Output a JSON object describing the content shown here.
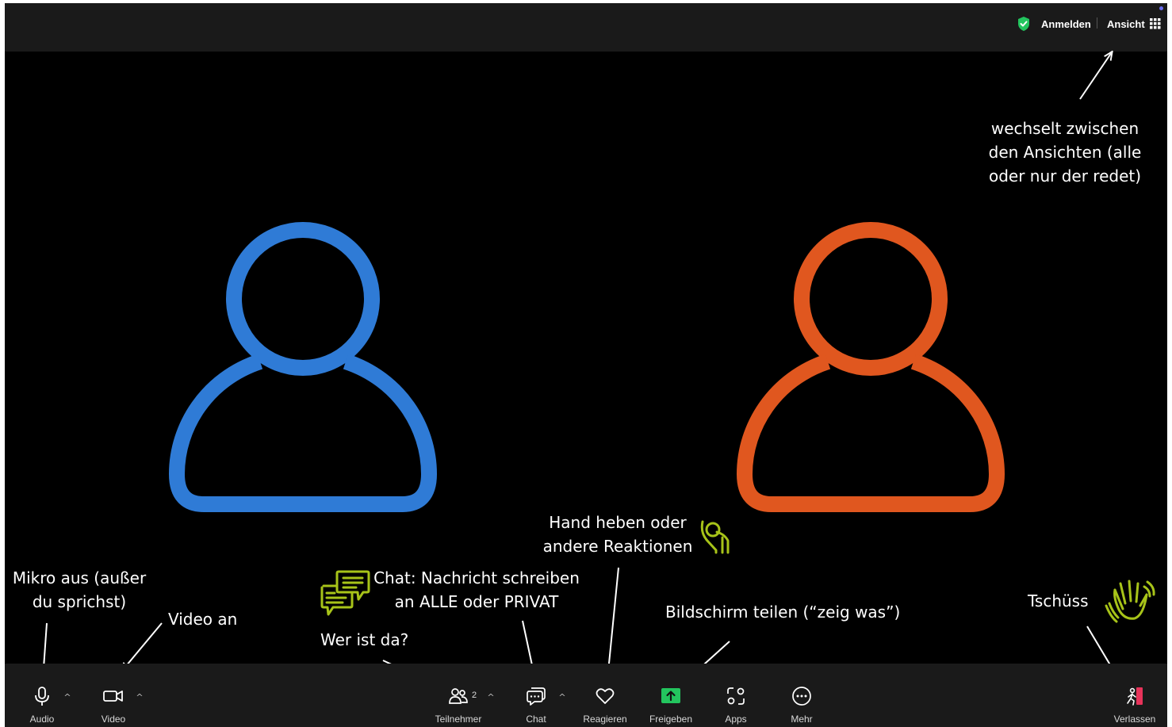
{
  "topbar": {
    "signin_label": "Anmelden",
    "view_label": "Ansicht",
    "shield_icon": "green-shield-check-icon",
    "grid_icon": "grid-icon"
  },
  "participants": [
    {
      "color": "#2f7bd6",
      "icon": "person-icon"
    },
    {
      "color": "#e0571f",
      "icon": "person-icon"
    }
  ],
  "toolbar": {
    "audio_label": "Audio",
    "video_label": "Video",
    "participants_label": "Teilnehmer",
    "participants_count": "2",
    "chat_label": "Chat",
    "react_label": "Reagieren",
    "share_label": "Freigeben",
    "apps_label": "Apps",
    "more_label": "Mehr",
    "leave_label": "Verlassen",
    "share_color": "#23c55e",
    "leave_color": "#e8335a"
  },
  "annotations": {
    "view_line1": "wechselt zwischen",
    "view_line2": "den Ansichten (alle",
    "view_line3": "oder nur der redet)",
    "mic_line1": "Mikro aus (außer",
    "mic_line2": "du sprichst)",
    "video": "Video an",
    "chat_line1": "Chat: Nachricht schreiben",
    "chat_line2": "an ALLE oder PRIVAT",
    "who": "Wer ist da?",
    "hand_line1": "Hand heben oder",
    "hand_line2": "andere Reaktionen",
    "share": "Bildschirm teilen (“zeig was”)",
    "bye": "Tschüss",
    "accent_color": "#a7c319"
  }
}
